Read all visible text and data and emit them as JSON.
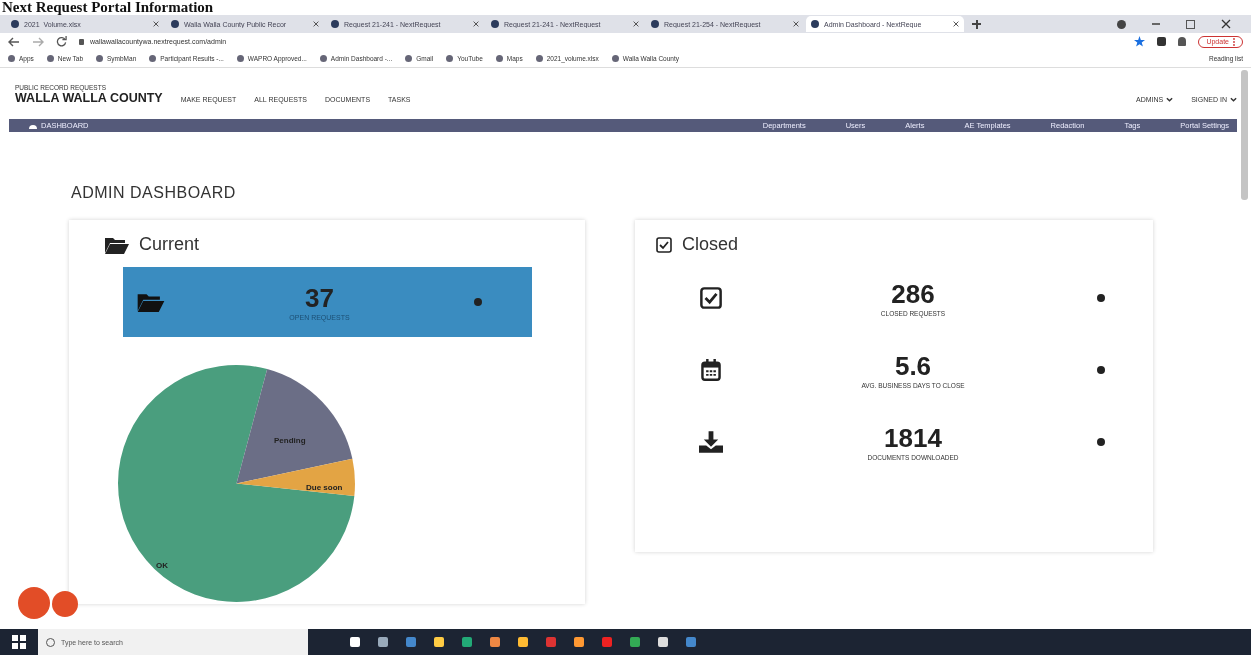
{
  "document_heading": "Next Request Portal Information",
  "browser": {
    "tabs": [
      {
        "title": "2021_Volume.xlsx",
        "selected": false
      },
      {
        "title": "Walla Walla County Public Recor",
        "selected": false
      },
      {
        "title": "Request 21-241 - NextRequest",
        "selected": false
      },
      {
        "title": "Request 21-241 - NextRequest",
        "selected": false
      },
      {
        "title": "Request 21-254 - NextRequest",
        "selected": false
      },
      {
        "title": "Admin Dashboard - NextReque",
        "selected": true
      }
    ],
    "url": "wallawallacountywa.nextrequest.com/admin",
    "update_button": "Update",
    "bookmarks": [
      "Apps",
      "New Tab",
      "SymbMan",
      "Participant Results -...",
      "WAPRO Approved...",
      "Admin Dashboard -...",
      "Gmail",
      "YouTube",
      "Maps",
      "2021_volume.xlsx",
      "Walla Walla County"
    ],
    "reading_list": "Reading list"
  },
  "site_header": {
    "subtitle": "PUBLIC RECORD REQUESTS",
    "title": "WALLA WALLA COUNTY",
    "nav": [
      "MAKE REQUEST",
      "ALL REQUESTS",
      "DOCUMENTS",
      "TASKS"
    ],
    "menus": [
      "ADMINS",
      "SIGNED IN"
    ]
  },
  "admin_bar": {
    "home": "DASHBOARD",
    "links": [
      "Departments",
      "Users",
      "Alerts",
      "AE Templates",
      "Redaction",
      "Tags",
      "Portal Settings"
    ]
  },
  "page_title": "ADMIN DASHBOARD",
  "current": {
    "title": "Current",
    "count": "37",
    "count_label": "OPEN REQUESTS",
    "pie_slices": [
      {
        "label": "OK",
        "color": "#4a9e7e"
      },
      {
        "label": "Pending",
        "color": "#6b6e86"
      },
      {
        "label": "Due soon",
        "color": "#e3a444"
      }
    ]
  },
  "closed": {
    "title": "Closed",
    "stats": [
      {
        "kind": "check",
        "value": "286",
        "label": "CLOSED REQUESTS"
      },
      {
        "kind": "calendar",
        "value": "5.6",
        "label": "AVG. BUSINESS DAYS TO CLOSE"
      },
      {
        "kind": "download",
        "value": "1814",
        "label": "DOCUMENTS DOWNLOADED"
      }
    ]
  },
  "taskbar": {
    "search_placeholder": "Type here to search"
  }
}
